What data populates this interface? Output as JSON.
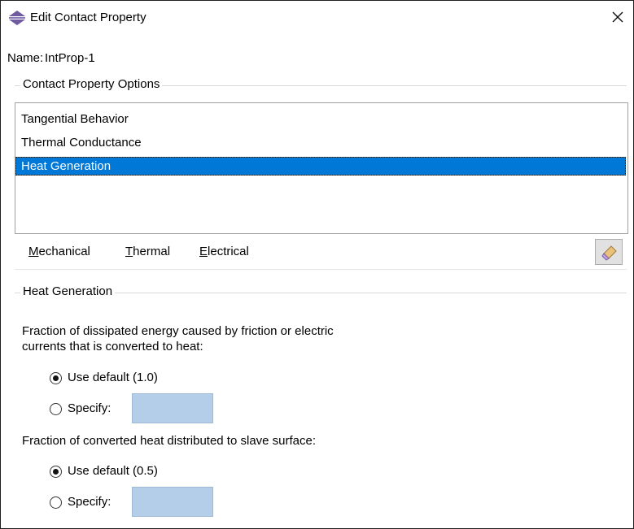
{
  "window": {
    "title": "Edit Contact Property"
  },
  "name": {
    "label": "Name:",
    "value": "IntProp-1"
  },
  "options": {
    "title": "Contact Property Options",
    "items": [
      {
        "label": "Tangential Behavior",
        "selected": false
      },
      {
        "label": "Thermal Conductance",
        "selected": false
      },
      {
        "label": "Heat Generation",
        "selected": true
      }
    ]
  },
  "menu": {
    "mechanical": {
      "accel": "M",
      "rest": "echanical"
    },
    "thermal": {
      "accel": "T",
      "rest": "hermal"
    },
    "electrical": {
      "accel": "E",
      "rest": "lectrical"
    }
  },
  "heat": {
    "title": "Heat Generation",
    "q1_line1": "Fraction of dissipated energy caused by friction or electric",
    "q1_line2": "currents that is converted to heat:",
    "q1_default": "Use default (1.0)",
    "q1_specify": "Specify:",
    "q1_value": "",
    "q2": "Fraction of converted heat distributed to slave surface:",
    "q2_default": "Use default (0.5)",
    "q2_specify": "Specify:",
    "q2_value": ""
  },
  "colors": {
    "selection": "#0078d7",
    "field": "#b4cde9",
    "accent_icon": "#7b5ea7"
  }
}
